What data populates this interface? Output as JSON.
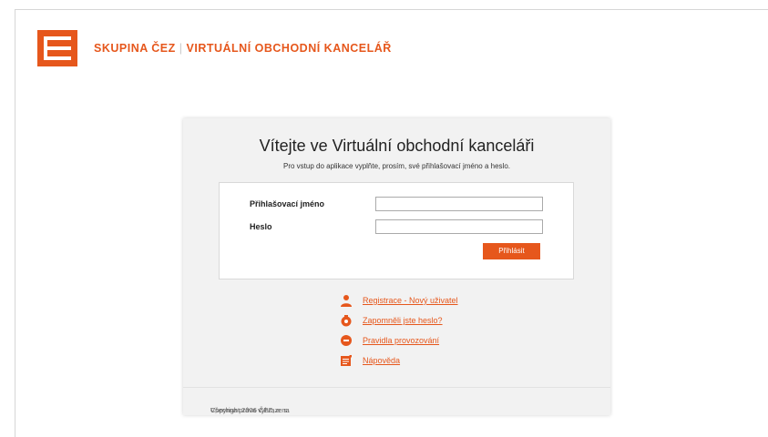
{
  "header": {
    "brand_name": "SKUPINA ČEZ",
    "brand_separator": "|",
    "brand_subtitle": "VIRTUÁLNÍ OBCHODNÍ KANCELÁŘ",
    "logo_icon": "cez-logo-icon"
  },
  "login": {
    "title": "Vítejte ve Virtuální obchodní kanceláři",
    "subtitle": "Pro vstup do aplikace vyplňte, prosím, své přihlašovací jméno a heslo.",
    "username_label": "Přihlašovací jméno",
    "username_value": "",
    "password_label": "Heslo",
    "password_value": "",
    "submit_label": "Přihlásit"
  },
  "links": [
    {
      "label": "Registrace - Nový uživatel",
      "icon": "user-icon"
    },
    {
      "label": "Zapomněli jste heslo?",
      "icon": "lock-icon"
    },
    {
      "label": "Pravidla provozování",
      "icon": "rules-icon"
    },
    {
      "label": "Nápověda",
      "icon": "help-icon"
    }
  ],
  "footer": {
    "copyright": "Copyright 2006 ČEZ, a. s.",
    "separator": "|",
    "rights": "Všechna práva vyhrazena"
  },
  "colors": {
    "accent": "#e6571c",
    "panel_bg": "#f2f2f2"
  }
}
